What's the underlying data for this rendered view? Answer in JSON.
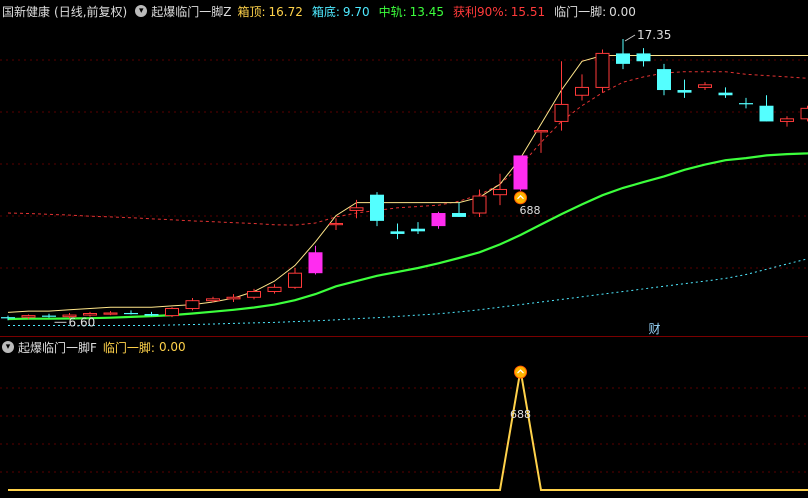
{
  "legend_main": {
    "stock": "国新健康",
    "mode": "(日线,前复权)",
    "indicator": "起爆临门一脚Z",
    "items": [
      {
        "label": "箱顶:",
        "value": "16.72",
        "color": "#ffd24a"
      },
      {
        "label": "箱底:",
        "value": "9.70",
        "color": "#4ee9ff"
      },
      {
        "label": "中轨:",
        "value": "13.45",
        "color": "#3cff3c"
      },
      {
        "label": "获利90%:",
        "value": "15.51",
        "color": "#ff3a3a"
      },
      {
        "label": "临门一脚:",
        "value": "0.00",
        "color": "#dddddd"
      }
    ]
  },
  "legend_sub": {
    "indicator": "起爆临门一脚F",
    "label": "临门一脚:",
    "value": "0.00",
    "color": "#ffd24a"
  },
  "annotations": {
    "high": "17.35",
    "low": "6.60",
    "signal_main": "688",
    "signal_sub": "688",
    "finance_tag": "财"
  },
  "chart_data": [
    {
      "type": "candlestick",
      "ylim": [
        6.0,
        18.0
      ],
      "candles": [
        {
          "o": 6.7,
          "h": 6.78,
          "l": 6.6,
          "c": 6.72,
          "up": false
        },
        {
          "o": 6.72,
          "h": 6.82,
          "l": 6.65,
          "c": 6.78,
          "up": true
        },
        {
          "o": 6.78,
          "h": 6.85,
          "l": 6.7,
          "c": 6.74,
          "up": false
        },
        {
          "o": 6.74,
          "h": 6.88,
          "l": 6.68,
          "c": 6.8,
          "up": true
        },
        {
          "o": 6.8,
          "h": 6.92,
          "l": 6.74,
          "c": 6.86,
          "up": true
        },
        {
          "o": 6.86,
          "h": 6.95,
          "l": 6.8,
          "c": 6.88,
          "up": true
        },
        {
          "o": 6.88,
          "h": 6.98,
          "l": 6.82,
          "c": 6.84,
          "up": false
        },
        {
          "o": 6.84,
          "h": 6.92,
          "l": 6.76,
          "c": 6.78,
          "up": false
        },
        {
          "o": 6.78,
          "h": 7.1,
          "l": 6.72,
          "c": 7.05,
          "up": true
        },
        {
          "o": 7.05,
          "h": 7.45,
          "l": 6.98,
          "c": 7.35,
          "up": true
        },
        {
          "o": 7.35,
          "h": 7.5,
          "l": 7.28,
          "c": 7.42,
          "up": true
        },
        {
          "o": 7.42,
          "h": 7.6,
          "l": 7.3,
          "c": 7.48,
          "up": true
        },
        {
          "o": 7.48,
          "h": 7.8,
          "l": 7.4,
          "c": 7.7,
          "up": true
        },
        {
          "o": 7.7,
          "h": 7.98,
          "l": 7.62,
          "c": 7.86,
          "up": true
        },
        {
          "o": 7.86,
          "h": 8.6,
          "l": 7.8,
          "c": 8.4,
          "up": true
        },
        {
          "o": 8.4,
          "h": 9.45,
          "l": 8.35,
          "c": 9.2,
          "up": true,
          "mag": true
        },
        {
          "o": 10.3,
          "h": 10.5,
          "l": 10.05,
          "c": 10.3,
          "up": true
        },
        {
          "o": 10.8,
          "h": 11.2,
          "l": 10.5,
          "c": 10.9,
          "up": true
        },
        {
          "o": 11.4,
          "h": 11.5,
          "l": 10.2,
          "c": 10.4,
          "up": false
        },
        {
          "o": 10.0,
          "h": 10.3,
          "l": 9.7,
          "c": 9.9,
          "up": false
        },
        {
          "o": 10.1,
          "h": 10.35,
          "l": 9.9,
          "c": 10.0,
          "up": false
        },
        {
          "o": 10.2,
          "h": 10.75,
          "l": 10.1,
          "c": 10.7,
          "up": true,
          "mag": true
        },
        {
          "o": 10.7,
          "h": 11.1,
          "l": 10.55,
          "c": 10.55,
          "up": false
        },
        {
          "o": 10.7,
          "h": 11.6,
          "l": 10.55,
          "c": 11.35,
          "up": true
        },
        {
          "o": 11.4,
          "h": 12.2,
          "l": 11.0,
          "c": 11.6,
          "up": true
        },
        {
          "o": 11.6,
          "h": 12.9,
          "l": 11.55,
          "c": 12.9,
          "up": true,
          "mag": true
        },
        {
          "o": 13.8,
          "h": 13.8,
          "l": 13.0,
          "c": 13.85,
          "up": true
        },
        {
          "o": 14.2,
          "h": 16.5,
          "l": 13.85,
          "c": 14.85,
          "up": true
        },
        {
          "o": 15.2,
          "h": 16.0,
          "l": 15.0,
          "c": 15.5,
          "up": true
        },
        {
          "o": 15.5,
          "h": 16.95,
          "l": 15.3,
          "c": 16.8,
          "up": true
        },
        {
          "o": 16.8,
          "h": 17.35,
          "l": 16.2,
          "c": 16.4,
          "up": false
        },
        {
          "o": 16.8,
          "h": 17.0,
          "l": 16.3,
          "c": 16.5,
          "up": false
        },
        {
          "o": 16.2,
          "h": 16.4,
          "l": 15.2,
          "c": 15.4,
          "up": false
        },
        {
          "o": 15.4,
          "h": 15.8,
          "l": 15.1,
          "c": 15.3,
          "up": false
        },
        {
          "o": 15.5,
          "h": 15.7,
          "l": 15.4,
          "c": 15.6,
          "up": true
        },
        {
          "o": 15.3,
          "h": 15.5,
          "l": 15.1,
          "c": 15.2,
          "up": false
        },
        {
          "o": 14.9,
          "h": 15.1,
          "l": 14.7,
          "c": 14.9,
          "up": false
        },
        {
          "o": 14.8,
          "h": 15.2,
          "l": 14.2,
          "c": 14.2,
          "up": false
        },
        {
          "o": 14.2,
          "h": 14.4,
          "l": 14.0,
          "c": 14.3,
          "up": true
        },
        {
          "o": 14.3,
          "h": 14.8,
          "l": 14.2,
          "c": 14.7,
          "up": true
        },
        {
          "o": 14.65,
          "h": 14.9,
          "l": 14.4,
          "c": 14.5,
          "up": false
        },
        {
          "o": 14.4,
          "h": 14.9,
          "l": 14.3,
          "c": 14.8,
          "up": true
        },
        {
          "o": 14.9,
          "h": 15.4,
          "l": 14.7,
          "c": 15.1,
          "up": true
        }
      ],
      "mid_band": [
        6.65,
        6.66,
        6.66,
        6.67,
        6.68,
        6.7,
        6.73,
        6.76,
        6.8,
        6.86,
        6.93,
        7.0,
        7.09,
        7.2,
        7.37,
        7.6,
        7.9,
        8.1,
        8.3,
        8.45,
        8.6,
        8.78,
        8.98,
        9.2,
        9.5,
        9.86,
        10.26,
        10.66,
        11.03,
        11.38,
        11.66,
        11.88,
        12.1,
        12.35,
        12.55,
        12.72,
        12.8,
        12.9,
        12.95,
        12.98,
        13.05,
        13.1,
        13.15
      ],
      "profit_90": [
        10.7,
        10.68,
        10.65,
        10.62,
        10.58,
        10.55,
        10.52,
        10.48,
        10.44,
        10.4,
        10.37,
        10.33,
        10.3,
        10.25,
        10.24,
        10.32,
        10.55,
        10.7,
        10.8,
        10.9,
        10.95,
        11.0,
        11.15,
        11.4,
        11.8,
        12.5,
        13.4,
        14.2,
        14.8,
        15.3,
        15.7,
        15.9,
        16.05,
        16.1,
        16.1,
        16.1,
        16.0,
        15.95,
        15.9,
        15.85,
        15.8,
        15.78,
        15.76
      ],
      "box_top": [
        6.9,
        6.95,
        6.95,
        7.0,
        7.05,
        7.1,
        7.1,
        7.1,
        7.15,
        7.2,
        7.3,
        7.45,
        7.7,
        8.1,
        8.7,
        9.6,
        10.6,
        11.1,
        11.1,
        11.1,
        11.1,
        11.1,
        11.1,
        11.3,
        11.8,
        12.8,
        14.1,
        15.4,
        16.5,
        16.72,
        16.72,
        16.72,
        16.72,
        16.72,
        16.72,
        16.72,
        16.72,
        16.72,
        16.72,
        16.72,
        16.72,
        16.72,
        16.72
      ],
      "box_bottom": [
        6.4,
        6.4,
        6.4,
        6.4,
        6.4,
        6.4,
        6.4,
        6.4,
        6.42,
        6.44,
        6.46,
        6.48,
        6.5,
        6.52,
        6.55,
        6.58,
        6.62,
        6.66,
        6.7,
        6.75,
        6.8,
        6.85,
        6.92,
        7.0,
        7.1,
        7.2,
        7.3,
        7.4,
        7.5,
        7.6,
        7.7,
        7.8,
        7.9,
        8.0,
        8.1,
        8.2,
        8.35,
        8.55,
        8.75,
        8.95,
        9.2,
        9.45,
        9.7
      ]
    },
    {
      "type": "line",
      "series_key": "临门一脚",
      "ylim": [
        0,
        700
      ],
      "values": [
        0,
        0,
        0,
        0,
        0,
        0,
        0,
        0,
        0,
        0,
        0,
        0,
        0,
        0,
        0,
        0,
        0,
        0,
        0,
        0,
        0,
        0,
        0,
        0,
        0,
        688,
        0,
        0,
        0,
        0,
        0,
        0,
        0,
        0,
        0,
        0,
        0,
        0,
        0,
        0,
        0,
        0,
        0
      ],
      "color": "#ffd24a"
    }
  ]
}
